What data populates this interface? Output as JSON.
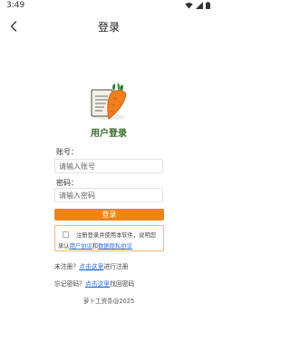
{
  "status": {
    "time": "3:49"
  },
  "nav": {
    "title": "登录"
  },
  "app": {
    "name": "用户登录"
  },
  "form": {
    "account_label": "账号：",
    "account_placeholder": "请输入账号",
    "password_label": "密码：",
    "password_placeholder": "请输入密码",
    "login_label": "登录"
  },
  "agreement": {
    "prefix": "注册登录并使用本软件，说明您承认",
    "user_link": "用户协议",
    "and": "和",
    "privacy_link": "数据隐私协议"
  },
  "register": {
    "prefix": "未注册？",
    "link": "点击这里",
    "suffix": "进行注册"
  },
  "forgot": {
    "prefix": "忘记密码？",
    "link": "点击这里",
    "suffix": "找回密码"
  },
  "footer": {
    "text": "萝卜工资条@2025"
  },
  "colors": {
    "accent": "#f0841a",
    "link": "#2a6fd6",
    "app_name": "#3a6b2a"
  },
  "icons": {
    "back": "chevron-left-icon",
    "wifi": "wifi-icon",
    "signal": "signal-icon",
    "battery": "battery-icon",
    "logo": "carrot-document-logo"
  }
}
